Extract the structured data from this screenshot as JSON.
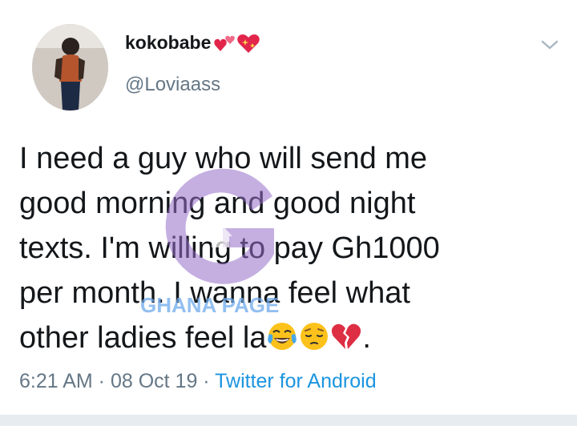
{
  "user": {
    "display_name": "kokobabe",
    "handle": "@Loviaass"
  },
  "tweet": {
    "lines": [
      "I need a guy who will send me",
      "good morning and good night",
      "texts. I'm willing to pay Gh1000",
      "per month. I wanna feel what",
      "other ladies feel la"
    ],
    "end_punct": ".",
    "emojis": [
      "tears-of-joy-emoji",
      "pensive-emoji",
      "broken-heart-emoji"
    ]
  },
  "meta": {
    "time": "6:21 AM",
    "sep1": " · ",
    "date": "08 Oct 19",
    "sep2": " · ",
    "source": "Twitter for Android"
  },
  "watermark": {
    "text": "GHANA PAGE"
  },
  "colors": {
    "text": "#14171a",
    "secondary": "#657786",
    "link": "#1b95e0",
    "watermark": "#3b8de0"
  },
  "icons": {
    "menu": "chevron-down-icon",
    "name_badges": [
      "two-hearts-icon",
      "sparkling-heart-icon"
    ]
  }
}
